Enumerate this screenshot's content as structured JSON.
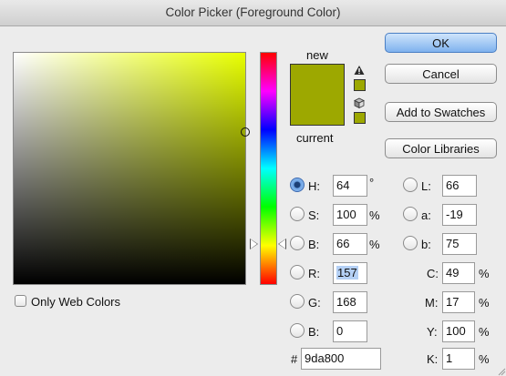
{
  "window": {
    "title": "Color Picker (Foreground Color)"
  },
  "colors": {
    "current": "#9da800",
    "accent": "#7fb2ee"
  },
  "preview": {
    "new_label": "new",
    "current_label": "current",
    "gamut_warning_icon": "warning-triangle-icon",
    "web_safe_icon": "cube-icon"
  },
  "buttons": {
    "ok": "OK",
    "cancel": "Cancel",
    "add_to_swatches": "Add to Swatches",
    "color_libraries": "Color Libraries"
  },
  "hsb": {
    "h": {
      "label": "H:",
      "value": "64",
      "unit": "°"
    },
    "s": {
      "label": "S:",
      "value": "100",
      "unit": "%"
    },
    "b": {
      "label": "B:",
      "value": "66",
      "unit": "%"
    }
  },
  "rgb": {
    "r": {
      "label": "R:",
      "value": "157"
    },
    "g": {
      "label": "G:",
      "value": "168"
    },
    "b": {
      "label": "B:",
      "value": "0"
    }
  },
  "lab": {
    "l": {
      "label": "L:",
      "value": "66"
    },
    "a": {
      "label": "a:",
      "value": "-19"
    },
    "b": {
      "label": "b:",
      "value": "75"
    }
  },
  "cmyk": {
    "c": {
      "label": "C:",
      "value": "49",
      "unit": "%"
    },
    "m": {
      "label": "M:",
      "value": "17",
      "unit": "%"
    },
    "y": {
      "label": "Y:",
      "value": "100",
      "unit": "%"
    },
    "k": {
      "label": "K:",
      "value": "1",
      "unit": "%"
    }
  },
  "hex": {
    "label": "#",
    "value": "9da800"
  },
  "options": {
    "only_web_colors": "Only Web Colors",
    "only_web_colors_checked": false
  }
}
